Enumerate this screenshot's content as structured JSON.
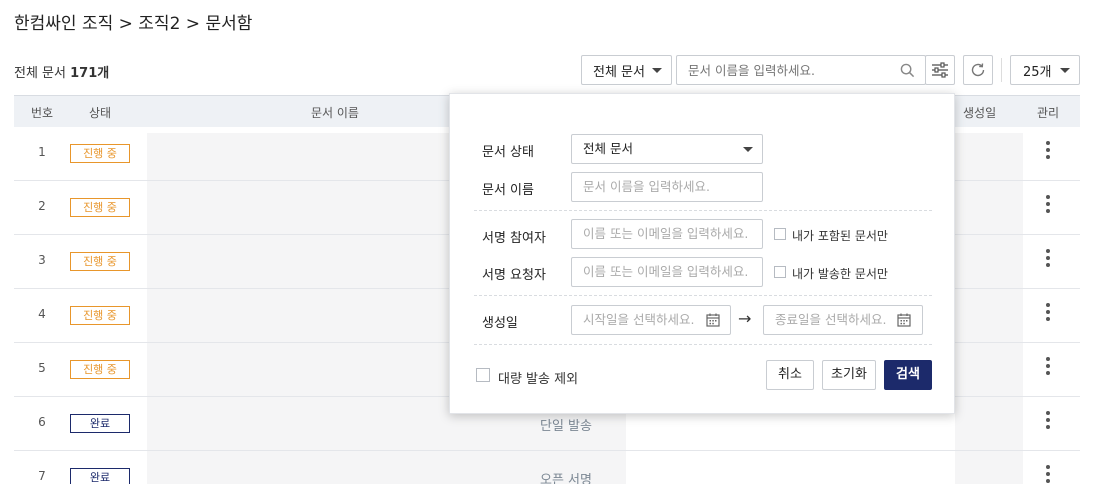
{
  "breadcrumb": "한컴싸인 조직 > 조직2 > 문서함",
  "total": {
    "prefix": "전체 문서 ",
    "count": "171개"
  },
  "toolbar": {
    "filter_select": "전체 문서",
    "search_placeholder": "문서 이름을 입력하세요.",
    "page_size": "25개"
  },
  "table": {
    "headers": {
      "num": "번호",
      "status": "상태",
      "name": "문서 이름",
      "created": "생성일",
      "manage": "관리"
    },
    "rows": [
      {
        "num": "1",
        "status": "진행 중",
        "state": "prog",
        "type": ""
      },
      {
        "num": "2",
        "status": "진행 중",
        "state": "prog",
        "type": ""
      },
      {
        "num": "3",
        "status": "진행 중",
        "state": "prog",
        "type": ""
      },
      {
        "num": "4",
        "status": "진행 중",
        "state": "prog",
        "type": ""
      },
      {
        "num": "5",
        "status": "진행 중",
        "state": "prog",
        "type": ""
      },
      {
        "num": "6",
        "status": "완료",
        "state": "done",
        "type": "단일 발송"
      },
      {
        "num": "7",
        "status": "완료",
        "state": "done",
        "type": "오픈 서명"
      }
    ]
  },
  "panel": {
    "doc_status_label": "문서 상태",
    "doc_status_value": "전체 문서",
    "doc_name_label": "문서 이름",
    "doc_name_placeholder": "문서 이름을 입력하세요.",
    "participant_label": "서명 참여자",
    "participant_placeholder": "이름 또는 이메일을 입력하세요.",
    "participant_check": "내가 포함된 문서만",
    "requester_label": "서명 요청자",
    "requester_placeholder": "이름 또는 이메일을 입력하세요.",
    "requester_check": "내가 발송한 문서만",
    "created_label": "생성일",
    "start_placeholder": "시작일을 선택하세요.",
    "end_placeholder": "종료일을 선택하세요.",
    "arrow": "→",
    "bulk_exclude": "대량 발송 제외",
    "cancel": "취소",
    "reset": "초기화",
    "search": "검색"
  },
  "colors": {
    "accent": "#1c2a6b",
    "progress": "#e8962b"
  }
}
